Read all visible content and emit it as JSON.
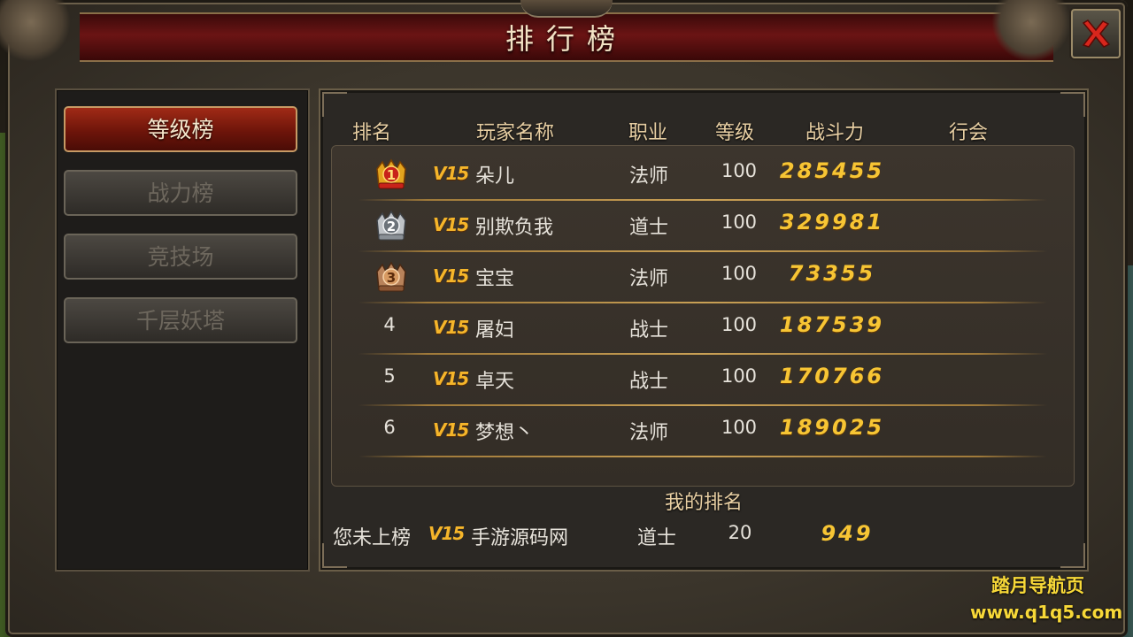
{
  "window": {
    "title": "排行榜",
    "close_icon": "close-x-icon"
  },
  "sidebar": {
    "tabs": [
      {
        "label": "等级榜",
        "active": true
      },
      {
        "label": "战力榜",
        "active": false
      },
      {
        "label": "竞技场",
        "active": false
      },
      {
        "label": "千层妖塔",
        "active": false
      }
    ]
  },
  "table": {
    "headers": {
      "rank": "排名",
      "name": "玩家名称",
      "job": "职业",
      "level": "等级",
      "power": "战斗力",
      "guild": "行会"
    },
    "rows": [
      {
        "rank": "1",
        "medal": "gold-medal-icon",
        "vip": "V15",
        "name": "朵儿",
        "job": "法师",
        "level": "100",
        "power": "285455",
        "guild": ""
      },
      {
        "rank": "2",
        "medal": "silver-medal-icon",
        "vip": "V15",
        "name": "别欺负我",
        "job": "道士",
        "level": "100",
        "power": "329981",
        "guild": ""
      },
      {
        "rank": "3",
        "medal": "bronze-medal-icon",
        "vip": "V15",
        "name": "宝宝",
        "job": "法师",
        "level": "100",
        "power": "73355",
        "guild": ""
      },
      {
        "rank": "4",
        "medal": "",
        "vip": "V15",
        "name": "屠妇",
        "job": "战士",
        "level": "100",
        "power": "187539",
        "guild": ""
      },
      {
        "rank": "5",
        "medal": "",
        "vip": "V15",
        "name": "卓天",
        "job": "战士",
        "level": "100",
        "power": "170766",
        "guild": ""
      },
      {
        "rank": "6",
        "medal": "",
        "vip": "V15",
        "name": "梦想丶",
        "job": "法师",
        "level": "100",
        "power": "189025",
        "guild": ""
      }
    ]
  },
  "my_rank": {
    "label": "我的排名",
    "rank": "您未上榜",
    "vip": "V15",
    "name": "手游源码网",
    "job": "道士",
    "level": "20",
    "power": "949"
  },
  "watermark": {
    "line1": "踏月导航页",
    "line2": "www.q1q5.com"
  },
  "colors": {
    "accent_gold": "#f7c534",
    "tab_active_red": "#8a1c0e",
    "title_bar_red": "#6b1414"
  }
}
